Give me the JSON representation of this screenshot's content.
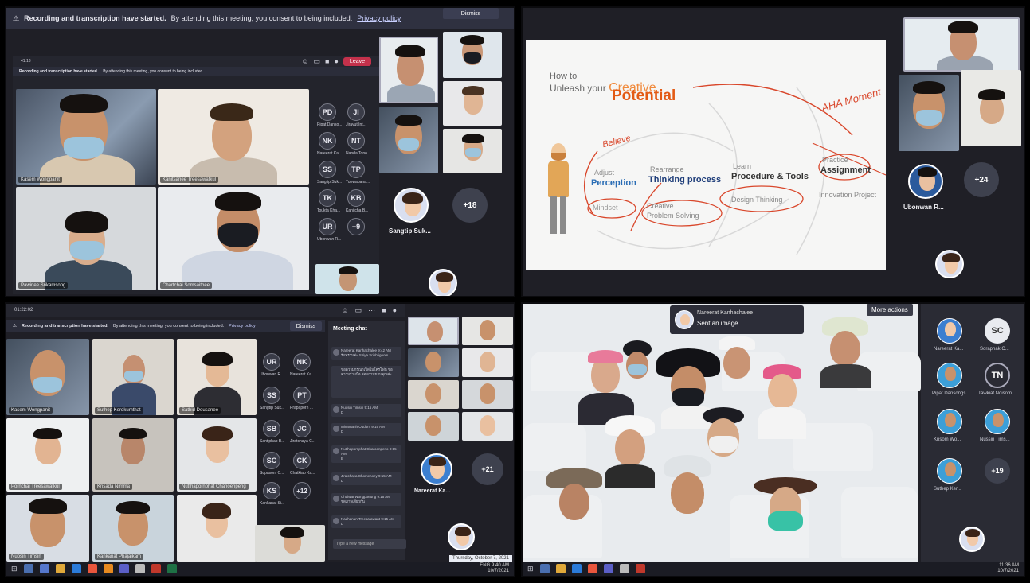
{
  "q1": {
    "banner": {
      "warning_icon": "warning-icon",
      "text": "Recording and transcription have started.",
      "consent": "By attending this meeting, you consent to being included.",
      "link": "Privacy policy",
      "dismiss": "Dismiss"
    },
    "timer": "41:18",
    "leave": "Leave",
    "tiles": [
      "Kasem Wongpanit",
      "Kanitsanee Treesawatkul",
      "Pawinee Srikamsong",
      "Chartchai Somsaithee"
    ],
    "avatars": [
      {
        "initials": "PD",
        "name": "Pipat Danso..."
      },
      {
        "initials": "JI",
        "name": "Jirayut Int..."
      },
      {
        "initials": "NK",
        "name": "Nareerat Ka..."
      },
      {
        "initials": "NT",
        "name": "Nanda Tono..."
      },
      {
        "initials": "SS",
        "name": "Sangtip Suk..."
      },
      {
        "initials": "TP",
        "name": "Tuewapana..."
      },
      {
        "initials": "TK",
        "name": "Toukta Kha..."
      },
      {
        "initials": "KB",
        "name": "Kanitcha B..."
      },
      {
        "initials": "UR",
        "name": "Ubonwan R..."
      }
    ],
    "more_people": "+9",
    "featured_name": "Sangtip Suk...",
    "overflow": "+18"
  },
  "q2": {
    "slide": {
      "how_to": "How to",
      "unleash": "Unleash your",
      "creative": "Creative",
      "potential": "Potential",
      "adjust": "Adjust",
      "perception": "Perception",
      "mindset": "Mindset",
      "rearrange": "Rearrange",
      "thinking": "Thinking process",
      "creative_ps": "Creative",
      "problem_solving": "Problem Solving",
      "learn": "Learn",
      "procedure": "Procedure & Tools",
      "design_thinking": "Design Thinking",
      "practice": "Practice",
      "assignment": "Assignment",
      "innovation": "Innovation Project",
      "handwriting_1": "Believe",
      "handwriting_2": "AHA Moment"
    },
    "featured_name": "Ubonwan R...",
    "overflow": "+24"
  },
  "q3": {
    "timer": "01:22:02",
    "banner": {
      "text": "Recording and transcription have started.",
      "consent": "By attending this meeting, you consent to being included.",
      "link": "Privacy policy",
      "dismiss": "Dismiss"
    },
    "tiles": [
      "Kasem Wongpanit",
      "Suthep Kerdkumthat",
      "Sathid Dousanee",
      "Pornchai Treesawatkul",
      "Krisada Nimma",
      "Nutthapornphat Chanoenpeng",
      "Nuosin Timsin",
      "Kankanat Phajaikam"
    ],
    "avatars": [
      {
        "initials": "UR",
        "name": "Ubonwan R..."
      },
      {
        "initials": "NK",
        "name": "Nareerat Ka..."
      },
      {
        "initials": "SS",
        "name": "Sangtip Suk..."
      },
      {
        "initials": "PT",
        "name": "Prapaporn ..."
      },
      {
        "initials": "SB",
        "name": "Santiphap B..."
      },
      {
        "initials": "JC",
        "name": "Jiratchaya C..."
      },
      {
        "initials": "SC",
        "name": "Supasom C..."
      },
      {
        "initials": "CK",
        "name": "Chatkiao Ka..."
      },
      {
        "initials": "KS",
        "name": "Kankanat Si..."
      }
    ],
    "more_people": "+12",
    "chat": {
      "title": "Meeting chat",
      "messages": [
        {
          "author": "Nareerat Kanhachalee",
          "time": "9:42 AM",
          "text": "รับทราบค่ะ Siriya Sriobtigoom"
        },
        {
          "author": "",
          "time": "",
          "text": "ขอความกรุณาเปิดไมโครโฟน ขอความร่วมมือ สอบถามขอบคุณค่ะ"
        },
        {
          "author": "Nuosin Timsin",
          "time": "9:15 AM",
          "text": "D"
        },
        {
          "author": "Minamanh Oudom",
          "time": "9:15 AM",
          "text": "D"
        },
        {
          "author": "Nutthapornphat Charoenpeno",
          "time": "9:15 AM",
          "text": "B"
        },
        {
          "author": "Jiratchaya Chomchoey",
          "time": "9:15 AM",
          "text": "D"
        },
        {
          "author": "Chaiwat Wongpoeung",
          "time": "9:15 AM",
          "text": "ชุดภาพเดียวกัน"
        },
        {
          "author": "Nadhanun Treesatawant",
          "time": "9:15 AM",
          "text": "D"
        }
      ],
      "placeholder": "Type a new message"
    },
    "featured_name": "Nareerat Ka...",
    "overflow": "+21",
    "date_tooltip": "Thursday, October 7, 2021",
    "clock": "9:40 AM",
    "date": "10/7/2021",
    "lang": "ENG"
  },
  "q4": {
    "toast_name": "Nareerat Kanhachalee",
    "toast_msg": "Sent an image",
    "more_actions": "More actions",
    "people": [
      {
        "initials": "",
        "name": "Nareerat Ka..."
      },
      {
        "initials": "SC",
        "name": "Soraphak C..."
      },
      {
        "initials": "",
        "name": "Pipat Dansongs..."
      },
      {
        "initials": "TN",
        "name": "Tawkiat Noisom..."
      },
      {
        "initials": "",
        "name": "Krisom Wo..."
      },
      {
        "initials": "",
        "name": "Nussin Tims..."
      },
      {
        "initials": "",
        "name": "Suthep Ker..."
      }
    ],
    "overflow": "+19",
    "clock": "11:36 AM",
    "date": "10/7/2021"
  }
}
